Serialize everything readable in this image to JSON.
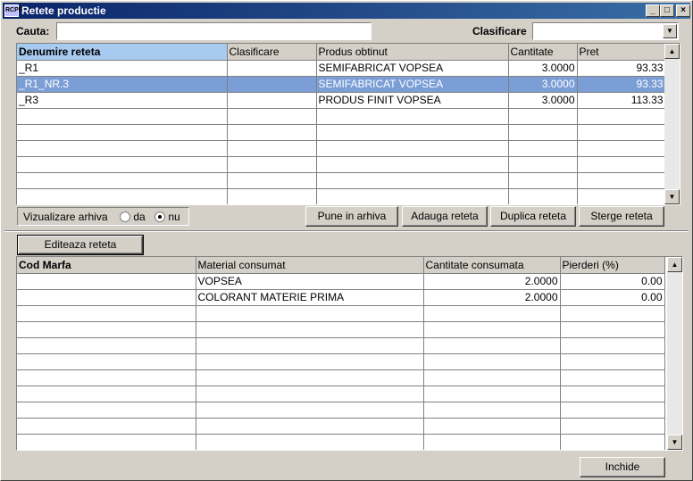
{
  "window": {
    "title": "Retete productie",
    "icon": "app-icon",
    "icon_text": "RCPR"
  },
  "search": {
    "label": "Cauta:",
    "value": ""
  },
  "classification": {
    "label": "Clasificare",
    "value": ""
  },
  "recipes": {
    "columns": [
      "Denumire reteta",
      "Clasificare",
      "Produs obtinut",
      "Cantitate",
      "Pret"
    ],
    "rows": [
      {
        "name": "_R1",
        "classification": "",
        "product": "SEMIFABRICAT VOPSEA",
        "quantity": "3.0000",
        "price": "93.33",
        "selected": false
      },
      {
        "name": "_R1_NR.3",
        "classification": "",
        "product": "SEMIFABRICAT VOPSEA",
        "quantity": "3.0000",
        "price": "93.33",
        "selected": true
      },
      {
        "name": "_R3",
        "classification": "",
        "product": "PRODUS FINIT VOPSEA",
        "quantity": "3.0000",
        "price": "113.33",
        "selected": false
      }
    ]
  },
  "archive": {
    "label": "Vizualizare arhiva",
    "option_yes": "da",
    "option_no": "nu",
    "selected": "nu"
  },
  "actions": {
    "archive": "Pune in arhiva",
    "add": "Adauga reteta",
    "duplicate": "Duplica reteta",
    "delete": "Sterge reteta",
    "edit": "Editeaza reteta",
    "close": "Inchide"
  },
  "materials": {
    "columns": [
      "Cod Marfa",
      "Material consumat",
      "Cantitate consumata",
      "Pierderi (%)"
    ],
    "rows": [
      {
        "code": "",
        "material": "VOPSEA",
        "quantity": "2.0000",
        "loss": "0.00"
      },
      {
        "code": "",
        "material": "COLORANT MATERIE PRIMA",
        "quantity": "2.0000",
        "loss": "0.00"
      }
    ]
  },
  "colors": {
    "title_bar_start": "#0a246a",
    "title_bar_end": "#3a6ea5",
    "selected_row": "#7b9ed6",
    "active_header": "#a6caf0",
    "window_bg": "#d4d0c8"
  }
}
